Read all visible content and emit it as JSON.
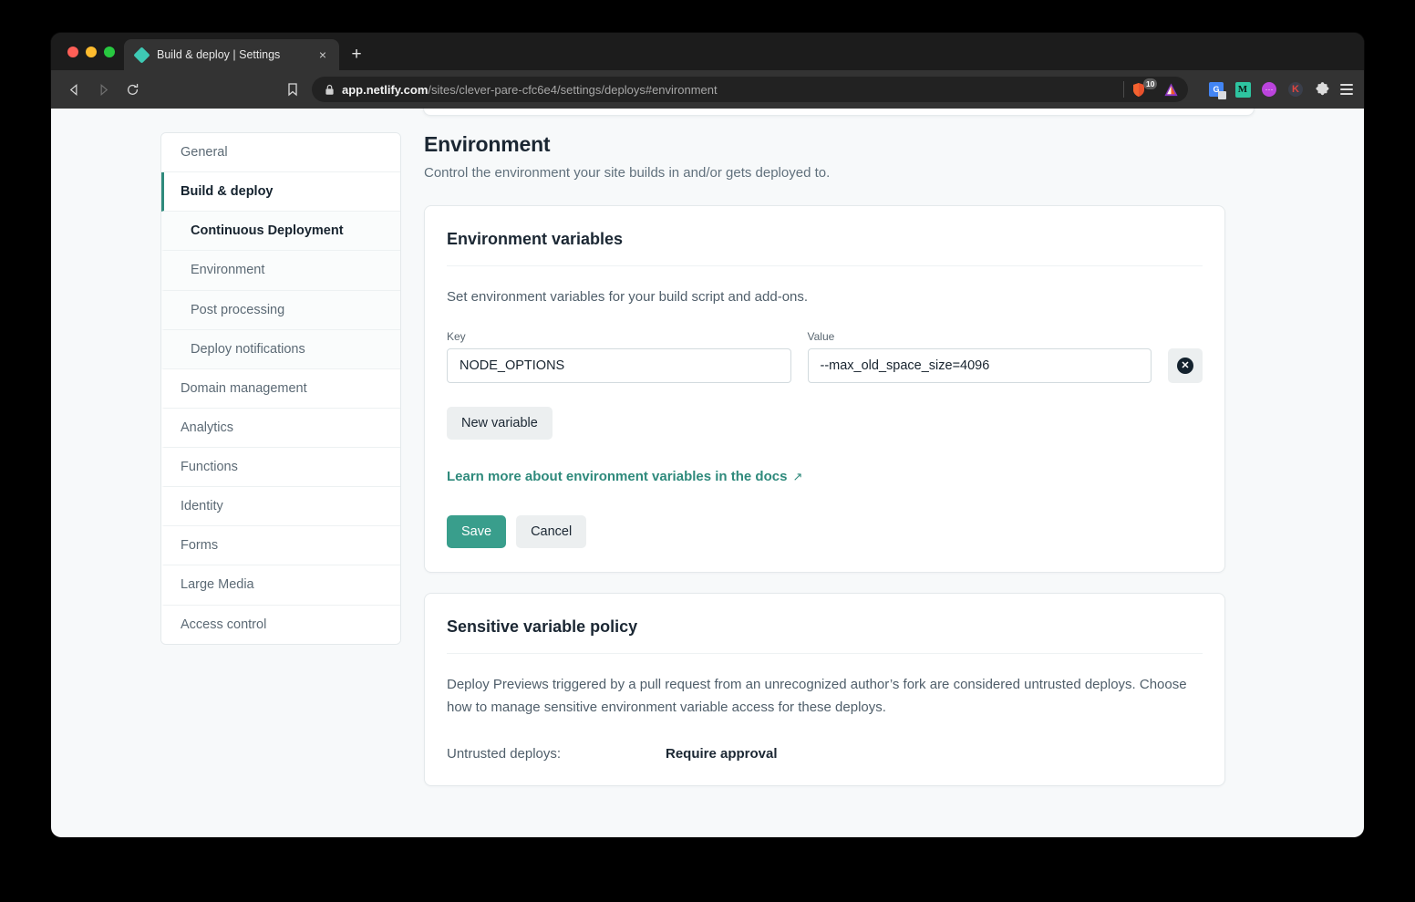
{
  "browser": {
    "tab": {
      "title": "Build & deploy | Settings",
      "favicon_name": "netlify-diamond-icon",
      "close_label": "×"
    },
    "new_tab_label": "+",
    "nav": {
      "back_label": "back-arrow-icon",
      "forward_label": "forward-arrow-icon",
      "reload_label": "reload-icon",
      "bookmark_label": "bookmark-icon"
    },
    "omnibox": {
      "host": "app.netlify.com",
      "path": "/sites/clever-pare-cfc6e4/settings/deploys#environment",
      "lock_icon": "lock-icon"
    },
    "shields": {
      "badge_count": "10",
      "icon": "brave-shields-icon"
    },
    "brave_logo": "brave-logo-icon",
    "extensions": [
      {
        "name": "google-translate-icon",
        "glyph": "G"
      },
      {
        "name": "medium-icon",
        "glyph": "M"
      },
      {
        "name": "purple-circle-extension-icon",
        "glyph": "···"
      },
      {
        "name": "kagi-extension-icon",
        "glyph": "K"
      },
      {
        "name": "puzzle-extensions-icon",
        "glyph": "puzzle"
      },
      {
        "name": "browser-menu-icon",
        "glyph": "hamburger"
      }
    ]
  },
  "sidebar": {
    "items": [
      {
        "label": "General",
        "level": "top",
        "state": "normal"
      },
      {
        "label": "Build & deploy",
        "level": "top",
        "state": "active"
      },
      {
        "label": "Continuous Deployment",
        "level": "sub",
        "state": "current"
      },
      {
        "label": "Environment",
        "level": "sub",
        "state": "normal"
      },
      {
        "label": "Post processing",
        "level": "sub",
        "state": "normal"
      },
      {
        "label": "Deploy notifications",
        "level": "sub",
        "state": "normal"
      },
      {
        "label": "Domain management",
        "level": "top",
        "state": "normal"
      },
      {
        "label": "Analytics",
        "level": "top",
        "state": "normal"
      },
      {
        "label": "Functions",
        "level": "top",
        "state": "normal"
      },
      {
        "label": "Identity",
        "level": "top",
        "state": "normal"
      },
      {
        "label": "Forms",
        "level": "top",
        "state": "normal"
      },
      {
        "label": "Large Media",
        "level": "top",
        "state": "normal"
      },
      {
        "label": "Access control",
        "level": "top",
        "state": "normal"
      }
    ]
  },
  "main": {
    "title": "Environment",
    "subtitle": "Control the environment your site builds in and/or gets deployed to.",
    "env_card": {
      "title": "Environment variables",
      "description": "Set environment variables for your build script and add-ons.",
      "key_label": "Key",
      "value_label": "Value",
      "variables": [
        {
          "key": "NODE_OPTIONS",
          "value": "--max_old_space_size=4096"
        }
      ],
      "remove_icon": "remove-variable-icon",
      "remove_glyph": "✕",
      "new_variable_label": "New variable",
      "docs_link_text": "Learn more about environment variables in the docs",
      "docs_link_arrow": "↗",
      "save_label": "Save",
      "cancel_label": "Cancel"
    },
    "policy_card": {
      "title": "Sensitive variable policy",
      "description": "Deploy Previews triggered by a pull request from an unrecognized author’s fork are considered untrusted deploys. Choose how to manage sensitive environment variable access for these deploys.",
      "row_label": "Untrusted deploys:",
      "row_value": "Require approval"
    }
  },
  "colors": {
    "accent_teal": "#399e8c",
    "link_teal": "#2f8a7c",
    "page_bg": "#f7f9fa",
    "card_bg": "#ffffff",
    "text_dark": "#1b2733",
    "chrome_dark": "#333333"
  }
}
